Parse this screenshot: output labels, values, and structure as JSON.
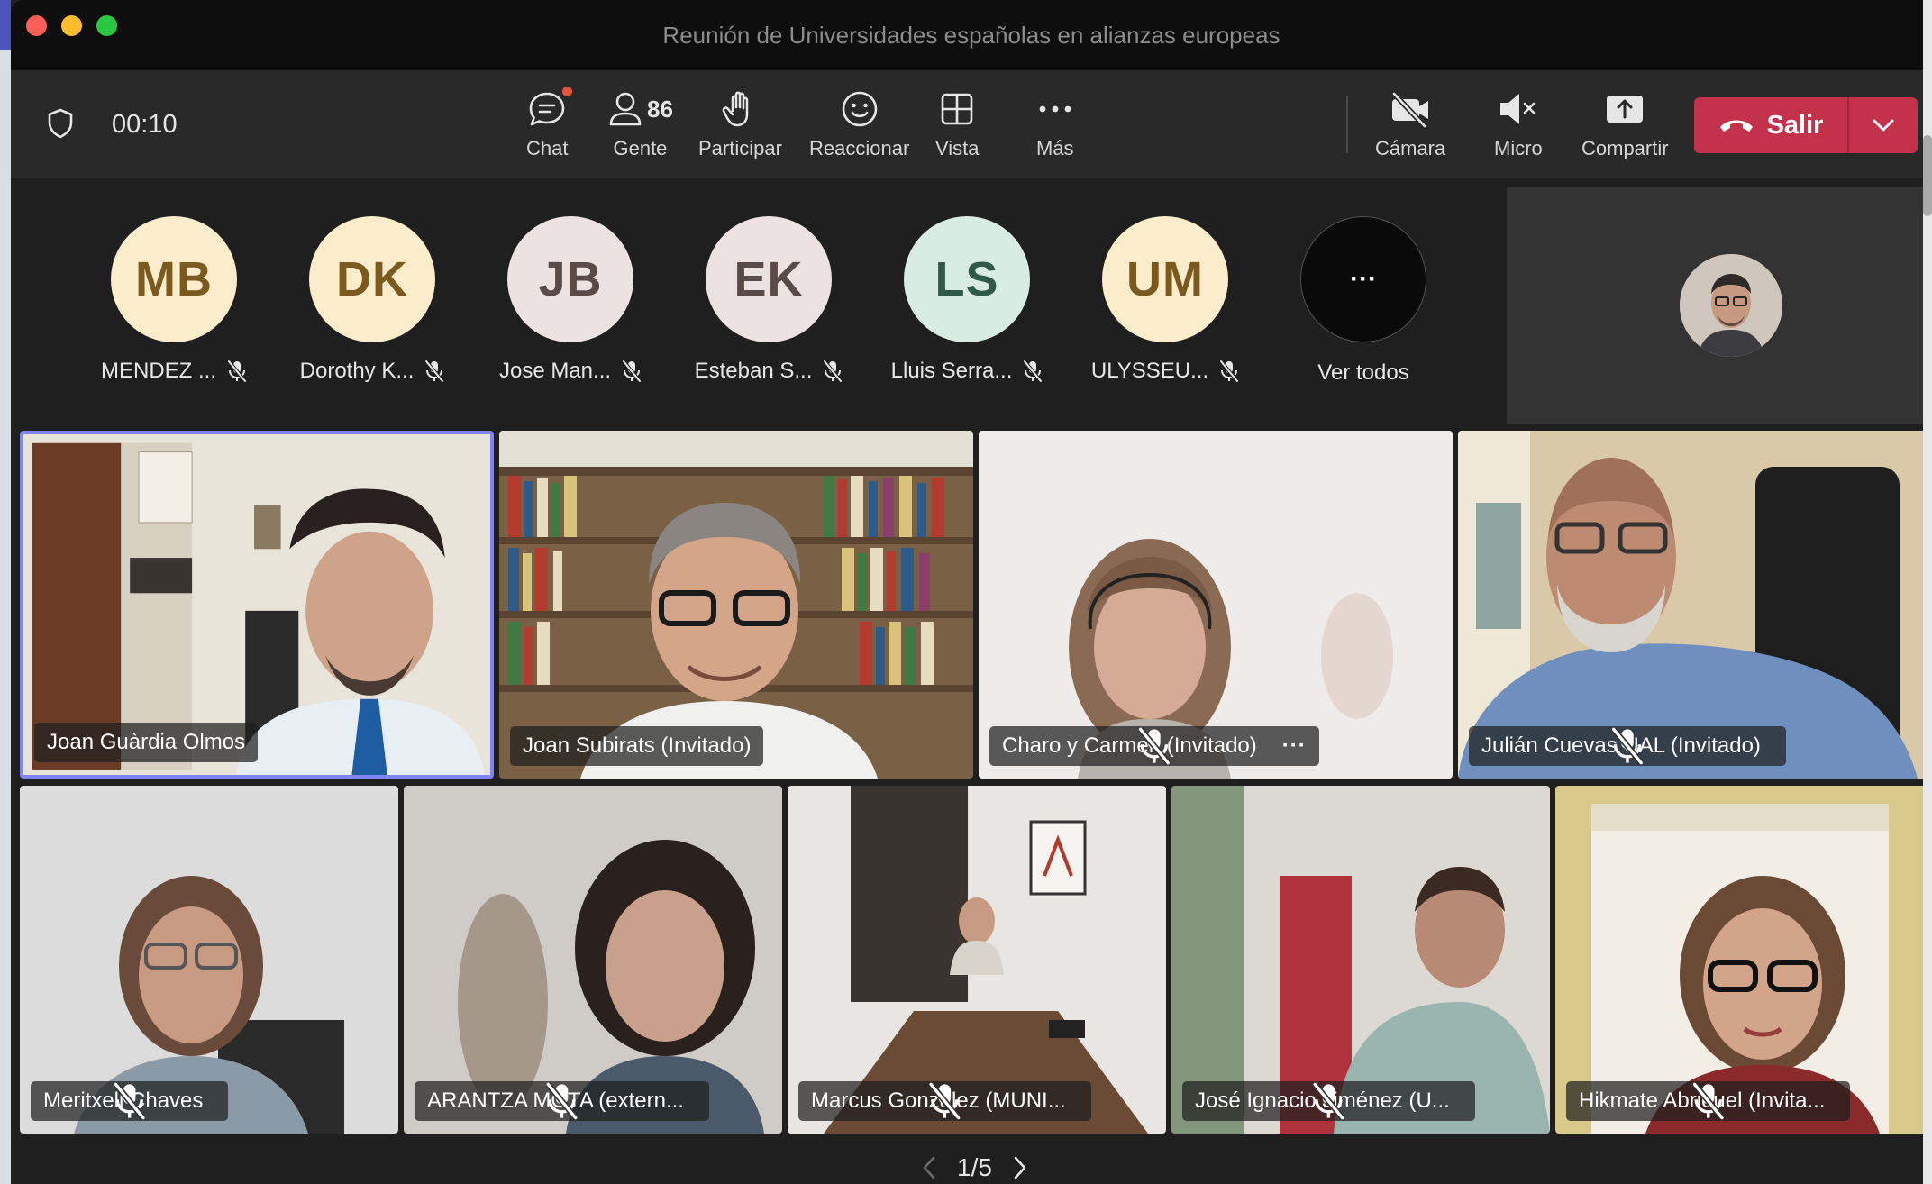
{
  "window": {
    "title": "Reunión de Universidades españolas en alianzas europeas"
  },
  "meeting": {
    "timer": "00:10"
  },
  "toolbar": {
    "chat": "Chat",
    "people": "Gente",
    "people_count": "86",
    "raise": "Participar",
    "react": "Reaccionar",
    "view": "Vista",
    "more": "Más",
    "camera": "Cámara",
    "mic": "Micro",
    "share": "Compartir",
    "leave": "Salir"
  },
  "strip": {
    "participants": [
      {
        "initials": "MB",
        "name": "MENDEZ ...",
        "bg": "#fbeccb",
        "fg": "#7a5a1f"
      },
      {
        "initials": "DK",
        "name": "Dorothy K...",
        "bg": "#fbeccb",
        "fg": "#7a5a1f"
      },
      {
        "initials": "JB",
        "name": "Jose Man...",
        "bg": "#ece2e1",
        "fg": "#5a4a48"
      },
      {
        "initials": "EK",
        "name": "Esteban S...",
        "bg": "#ece2e1",
        "fg": "#5a4a48"
      },
      {
        "initials": "LS",
        "name": "Lluis Serra...",
        "bg": "#d9ece3",
        "fg": "#2f5a47"
      },
      {
        "initials": "UM",
        "name": "ULYSSEU...",
        "bg": "#fbeccb",
        "fg": "#7a5a1f"
      }
    ],
    "more_label": "···",
    "see_all": "Ver todos"
  },
  "tiles": [
    {
      "name": "Joan Guàrdia Olmos"
    },
    {
      "name": "Joan Subirats (Invitado)"
    },
    {
      "name": "Charo y Carmen (Invitado)"
    },
    {
      "name": "Julián Cuevas UAL (Invitado)"
    },
    {
      "name": "Meritxell Chaves"
    },
    {
      "name": "ARANTZA MOTA (extern..."
    },
    {
      "name": "Marcus González (MUNI..."
    },
    {
      "name": "José Ignacio Jiménez (U..."
    },
    {
      "name": "Hikmate Abriouel (Invita..."
    }
  ],
  "pager": {
    "label": "1/5"
  },
  "colors": {
    "leave": "#c4314b",
    "selected": "#7f85f5",
    "toolbar": "#292929"
  }
}
